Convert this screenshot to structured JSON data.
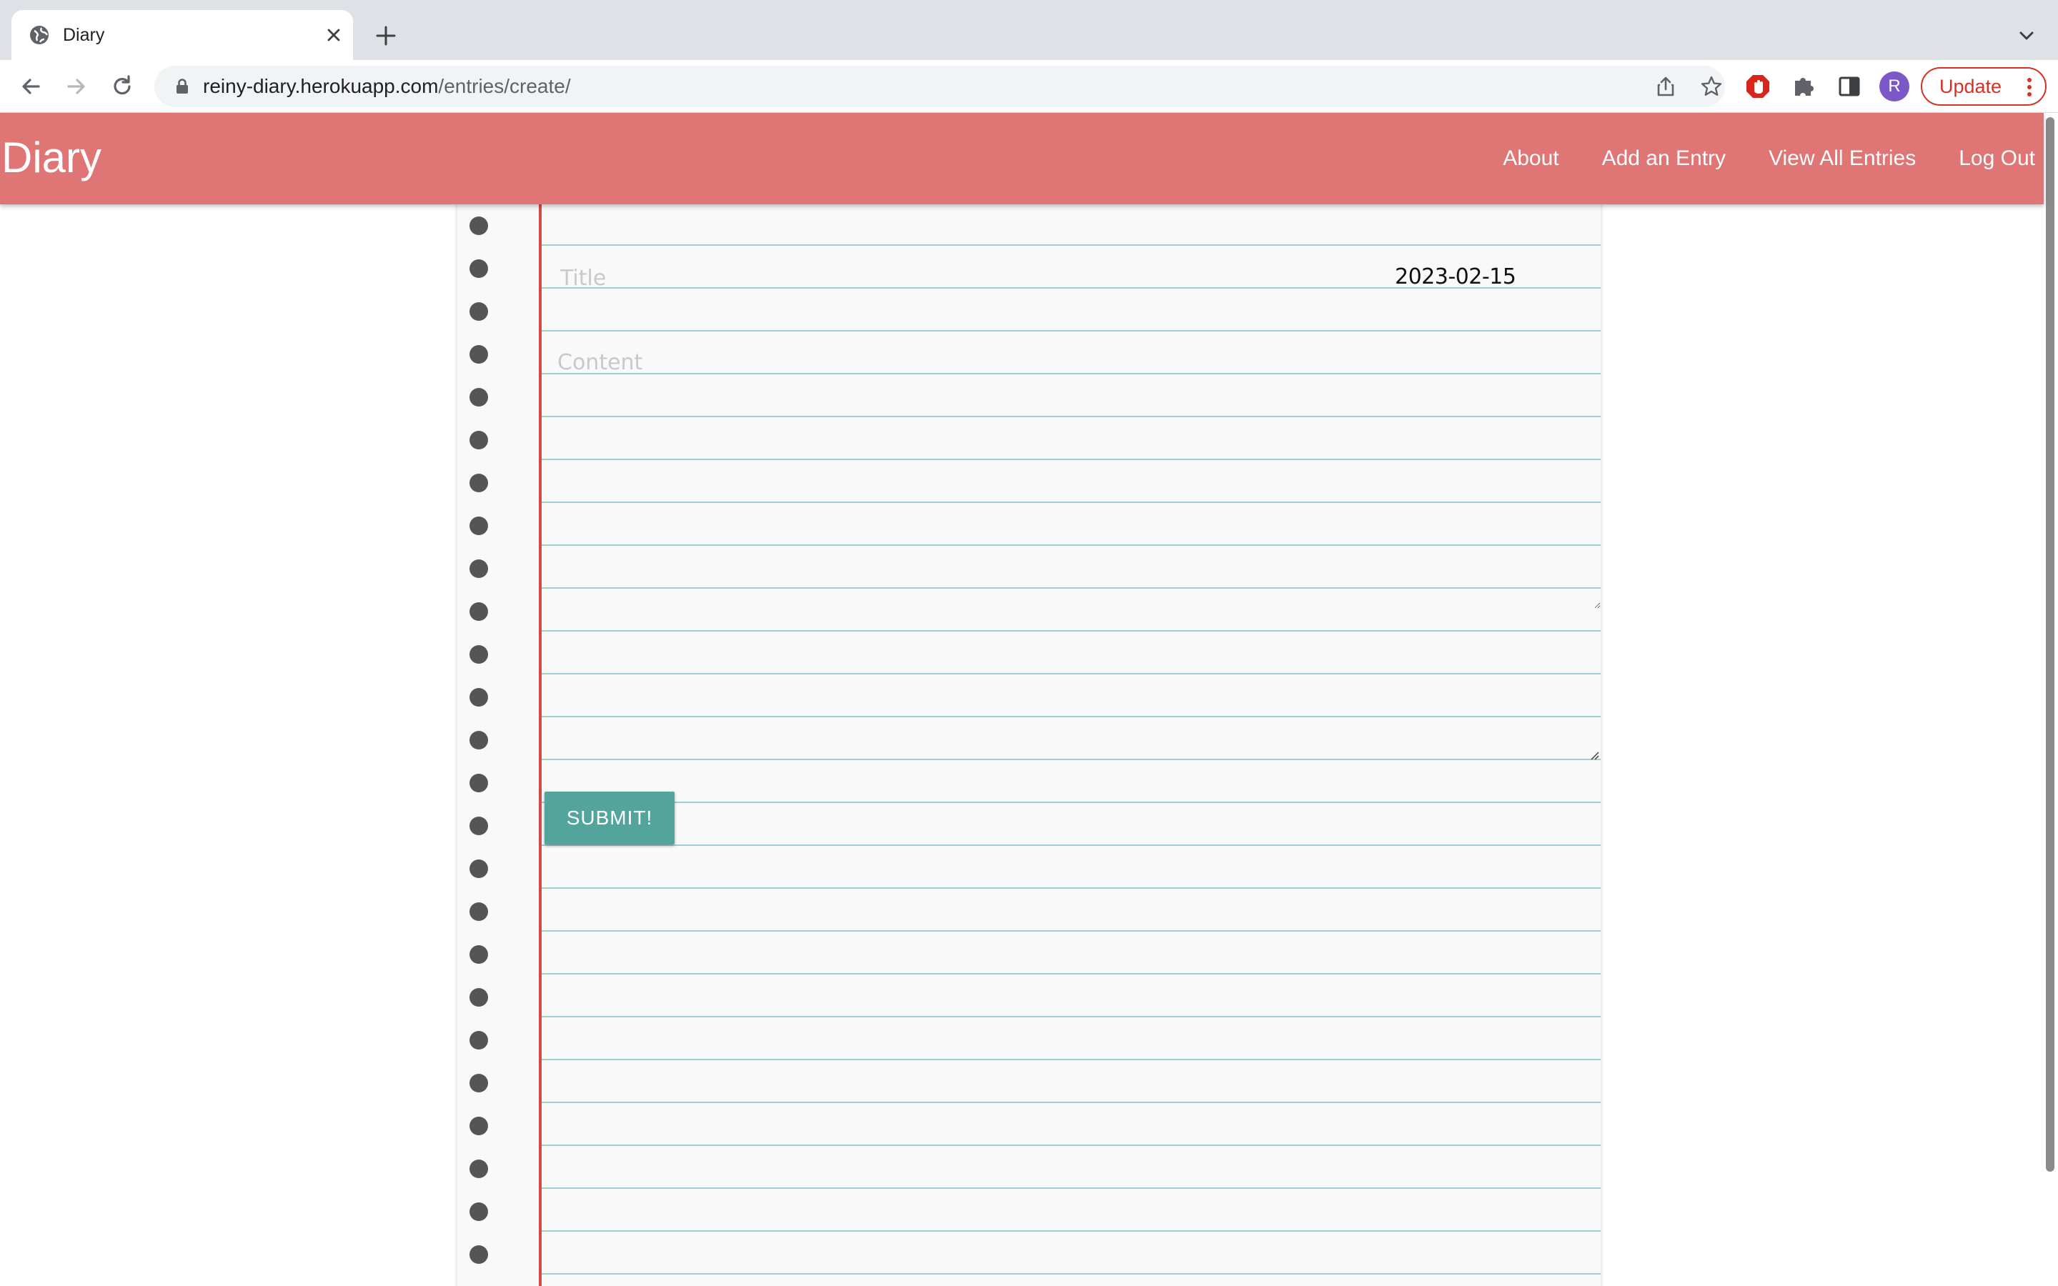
{
  "browser": {
    "tab_title": "Diary",
    "url_domain": "reiny-diary.herokuapp.com",
    "url_path": "/entries/create/",
    "profile_initial": "R",
    "update_label": "Update",
    "icons": {
      "favicon": "globe-icon",
      "tab_close": "close-icon",
      "new_tab": "plus-icon",
      "tab_search": "chevron-down-icon",
      "back": "arrow-left-icon",
      "forward": "arrow-right-icon",
      "reload": "reload-icon",
      "lock": "lock-icon",
      "share": "share-icon",
      "bookmark": "star-icon",
      "adblock": "adblock-icon",
      "extensions": "puzzle-icon",
      "side_panel": "side-panel-icon",
      "menu": "kebab-menu-icon"
    },
    "colors": {
      "update_accent": "#d93025",
      "avatar": "#7b57c7"
    }
  },
  "site": {
    "brand": "Diary",
    "nav": [
      {
        "label": "About"
      },
      {
        "label": "Add an Entry"
      },
      {
        "label": "View All Entries"
      },
      {
        "label": "Log Out"
      }
    ],
    "colors": {
      "navbar": "#e07575",
      "rule_line": "#9fcfd0",
      "margin_line": "#d14a44",
      "submit": "#52a49c"
    }
  },
  "form": {
    "title_placeholder": "Title",
    "title_value": "",
    "date": "2023-02-15",
    "content_placeholder": "Content",
    "content_value": "",
    "submit_label": "SUBMIT!"
  }
}
